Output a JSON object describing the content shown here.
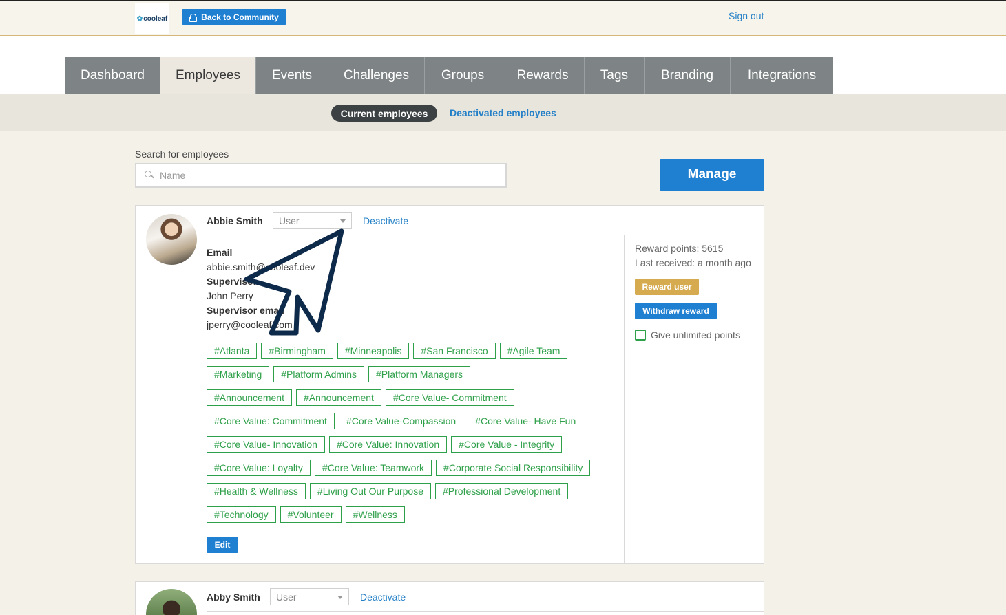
{
  "header": {
    "logo_text": "cooleaf",
    "back_label": "Back to Community",
    "signout_label": "Sign out"
  },
  "nav": {
    "tabs": [
      {
        "label": "Dashboard",
        "active": false
      },
      {
        "label": "Employees",
        "active": true
      },
      {
        "label": "Events",
        "active": false
      },
      {
        "label": "Challenges",
        "active": false
      },
      {
        "label": "Groups",
        "active": false
      },
      {
        "label": "Rewards",
        "active": false
      },
      {
        "label": "Tags",
        "active": false
      },
      {
        "label": "Branding",
        "active": false
      },
      {
        "label": "Integrations",
        "active": false
      }
    ]
  },
  "subnav": {
    "current_label": "Current employees",
    "deactivated_label": "Deactivated employees"
  },
  "search": {
    "label": "Search for employees",
    "placeholder": "Name",
    "value": ""
  },
  "manage_label": "Manage",
  "employees": [
    {
      "name": "Abbie Smith",
      "role": "User",
      "deactivate_label": "Deactivate",
      "email_label": "Email",
      "email": "abbie.smith@cooleaf.dev",
      "supervisor_label": "Supervisor",
      "supervisor": "John Perry",
      "supervisor_email_label": "Supervisor email",
      "supervisor_email": "jperry@cooleaf.com",
      "tag_rows": [
        [
          "#Atlanta",
          "#Birmingham",
          "#Minneapolis",
          "#San Francisco",
          "#Agile Team"
        ],
        [
          "#Marketing",
          "#Platform Admins",
          "#Platform Managers"
        ],
        [
          "#Announcement",
          "#Announcement",
          "#Core Value- Commitment"
        ],
        [
          "#Core Value: Commitment",
          "#Core Value-Compassion",
          "#Core Value- Have Fun"
        ],
        [
          "#Core Value- Innovation",
          "#Core Value: Innovation",
          "#Core Value - Integrity"
        ],
        [
          "#Core Value: Loyalty",
          "#Core Value: Teamwork",
          "#Corporate Social Responsibility"
        ],
        [
          "#Health & Wellness",
          "#Living Out Our Purpose",
          "#Professional Development"
        ],
        [
          "#Technology",
          "#Volunteer",
          "#Wellness"
        ]
      ],
      "edit_label": "Edit",
      "reward_points": "Reward points: 5615",
      "last_received": "Last received: a month ago",
      "reward_btn": "Reward user",
      "withdraw_btn": "Withdraw reward",
      "unlimited_label": "Give unlimited points"
    },
    {
      "name": "Abby Smith",
      "role": "User",
      "deactivate_label": "Deactivate"
    }
  ],
  "colors": {
    "accent_blue": "#1f7fd1",
    "tag_green": "#2fa04a",
    "reward_gold": "#d6aa4f",
    "nav_gray": "#7e8486"
  }
}
